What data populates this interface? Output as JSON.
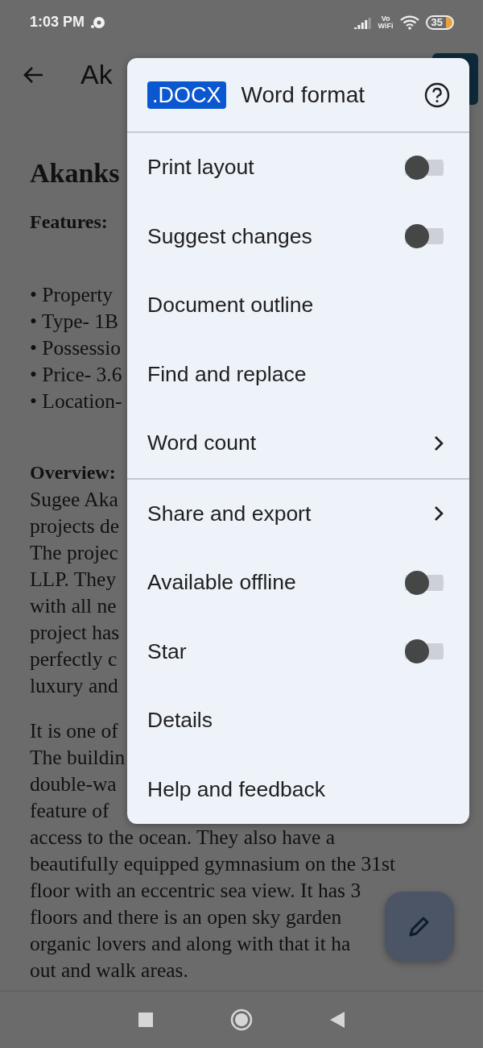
{
  "status_bar": {
    "time": "1:03 PM",
    "wifi_calling": [
      "Vo",
      "WiFi"
    ],
    "battery": "35"
  },
  "app_bar": {
    "title": "Ak"
  },
  "document": {
    "blocks": [
      {
        "kind": "title",
        "lines": [
          "Akanks"
        ]
      },
      {
        "kind": "label",
        "lines": [
          "Features:"
        ]
      },
      {
        "kind": "list",
        "lines": [
          "• Property",
          "• Type- 1B",
          "• Possessio",
          "• Price- 3.6",
          "• Location-"
        ]
      },
      {
        "kind": "label",
        "lines": [
          "Overview:"
        ]
      },
      {
        "kind": "paragraph",
        "lines": [
          "Sugee Aka",
          "projects de",
          "The projec",
          "LLP. They",
          "with all ne",
          "project has",
          "perfectly c",
          "luxury and"
        ]
      },
      {
        "kind": "paragraph",
        "lines": [
          "It is one of",
          "The buildin",
          "double-wa",
          "feature of",
          "access to the ocean. They also have a",
          "beautifully equipped gymnasium on the 31st",
          "floor with an eccentric sea view. It has 3",
          "floors and there is an open sky garden",
          "organic lovers and along with that it ha",
          "out and walk areas."
        ]
      }
    ]
  },
  "menu": {
    "header": {
      "badge": ".DOCX",
      "title": "Word format"
    },
    "sections": [
      [
        {
          "kind": "toggle",
          "label": "Print layout",
          "on": false
        },
        {
          "kind": "toggle",
          "label": "Suggest changes",
          "on": false
        },
        {
          "kind": "plain",
          "label": "Document outline"
        },
        {
          "kind": "plain",
          "label": "Find and replace"
        },
        {
          "kind": "submenu",
          "label": "Word count"
        }
      ],
      [
        {
          "kind": "submenu",
          "label": "Share and export"
        },
        {
          "kind": "toggle",
          "label": "Available offline",
          "on": false
        },
        {
          "kind": "toggle",
          "label": "Star",
          "on": false
        },
        {
          "kind": "plain",
          "label": "Details"
        },
        {
          "kind": "plain",
          "label": "Help and feedback"
        }
      ]
    ]
  }
}
